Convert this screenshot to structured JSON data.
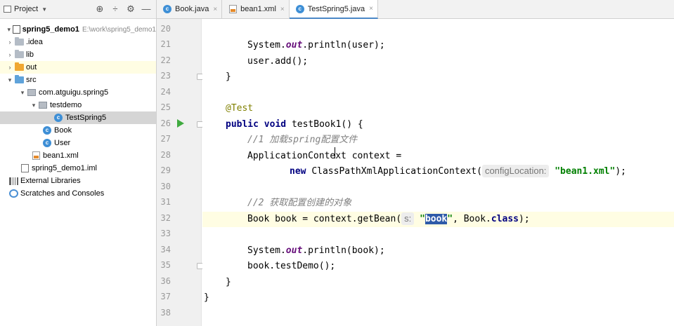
{
  "project_panel": {
    "title": "Project",
    "tools": [
      "⊕",
      "÷",
      "⚙",
      "—"
    ],
    "tree": [
      {
        "label": "spring5_demo1",
        "path": "E:\\work\\spring5_demo1",
        "icon": "module-icon",
        "arrow": "▾"
      },
      {
        "label": ".idea",
        "icon": "folder-icon",
        "arrow": "›"
      },
      {
        "label": "lib",
        "icon": "folder-icon",
        "arrow": "›"
      },
      {
        "label": "out",
        "icon": "folder-orange-icon",
        "arrow": "›"
      },
      {
        "label": "src",
        "icon": "source-folder-icon",
        "arrow": "▾"
      },
      {
        "label": "com.atguigu.spring5",
        "icon": "package-icon",
        "arrow": "▾"
      },
      {
        "label": "testdemo",
        "icon": "package-icon",
        "arrow": "▾"
      },
      {
        "label": "TestSpring5",
        "icon": "class-icon",
        "arrow": ""
      },
      {
        "label": "Book",
        "icon": "class-icon",
        "arrow": ""
      },
      {
        "label": "User",
        "icon": "class-icon",
        "arrow": ""
      },
      {
        "label": "bean1.xml",
        "icon": "xml-file-icon",
        "arrow": ""
      },
      {
        "label": "spring5_demo1.iml",
        "icon": "iml-file-icon",
        "arrow": ""
      },
      {
        "label": "External Libraries",
        "icon": "libraries-icon",
        "arrow": ""
      },
      {
        "label": "Scratches and Consoles",
        "icon": "scratches-icon",
        "arrow": ""
      }
    ]
  },
  "tabs": [
    {
      "label": "Book.java",
      "icon": "class-icon",
      "active": false
    },
    {
      "label": "bean1.xml",
      "icon": "xml-file-icon",
      "active": false
    },
    {
      "label": "TestSpring5.java",
      "icon": "class-icon",
      "active": true
    }
  ],
  "editor": {
    "line_numbers": [
      "20",
      "21",
      "22",
      "23",
      "24",
      "25",
      "26",
      "27",
      "28",
      "29",
      "30",
      "31",
      "32",
      "33",
      "34",
      "35",
      "36",
      "37",
      "38"
    ],
    "code": {
      "l21_a": "System.",
      "l21_field": "out",
      "l21_b": ".println(user);",
      "l22": "user.add();",
      "l23": "}",
      "l25": "@Test",
      "l26_kw1": "public",
      "l26_kw2": "void",
      "l26_rest": "testBook1() {",
      "l27": "//1 加载spring配置文件",
      "l28": "ApplicationContext context =",
      "l29_kw": "new",
      "l29_a": "ClassPathXmlApplicationContext(",
      "l29_hint": "configLocation:",
      "l29_str": "\"bean1.xml\"",
      "l29_b": ");",
      "l31": "//2 获取配置创建的对象",
      "l32_a": "Book book = context.getBean(",
      "l32_hint": "s:",
      "l32_q1": "\"",
      "l32_sel": "book",
      "l32_q2": "\"",
      "l32_b": ", Book.",
      "l32_kw": "class",
      "l32_c": ");",
      "l34_a": "System.",
      "l34_field": "out",
      "l34_b": ".println(book);",
      "l35": "book.testDemo();",
      "l36": "}",
      "l37": "}"
    }
  },
  "colors": {
    "keyword": "#000080",
    "annotation": "#808000",
    "comment": "#808080",
    "string": "#008000",
    "field": "#660e7a",
    "selection": "#2e5aa8",
    "current_line": "#fffde3"
  }
}
